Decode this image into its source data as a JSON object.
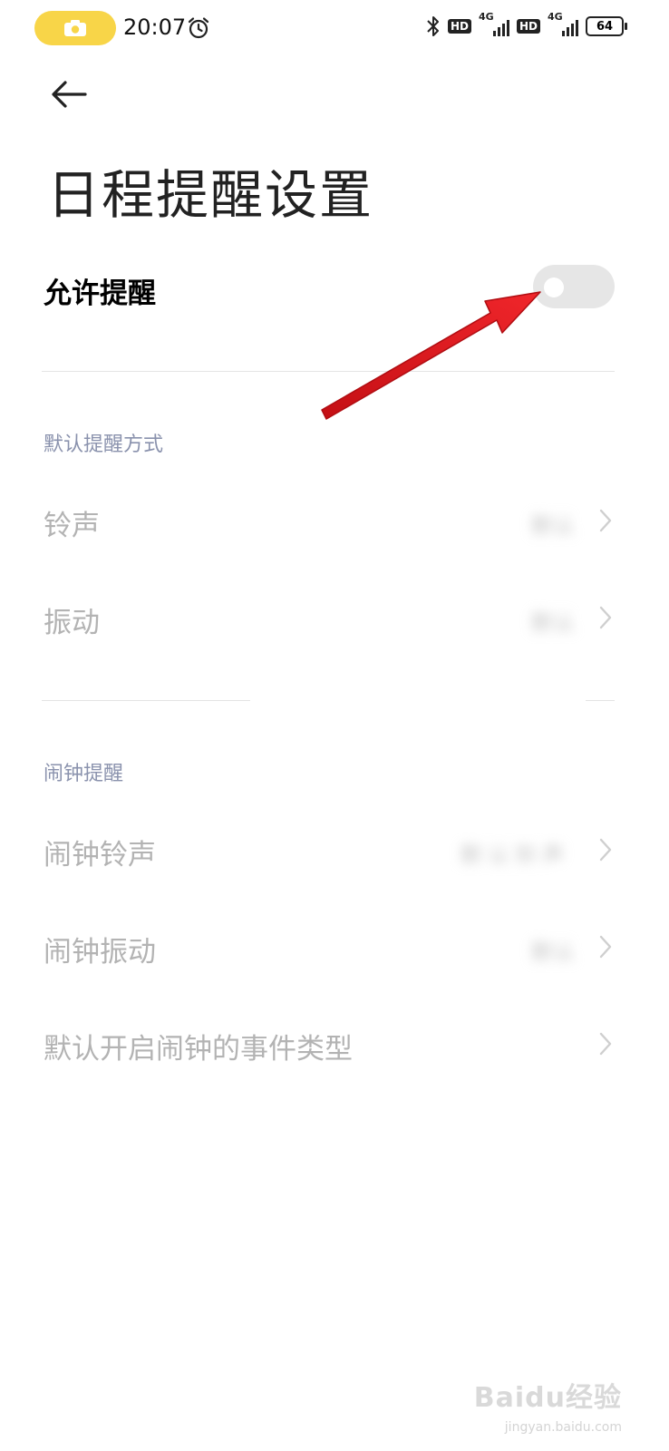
{
  "status_bar": {
    "time": "20:07",
    "hd_label_1": "HD",
    "net_label_1": "4G",
    "hd_label_2": "HD",
    "net_label_2": "4G",
    "battery": "64",
    "icons": [
      "camera-icon",
      "alarm-icon",
      "bluetooth-icon",
      "signal-icon",
      "battery-icon"
    ],
    "pill_color": "#f8d548"
  },
  "header": {
    "back_icon": "back-arrow-icon",
    "title": "日程提醒设置"
  },
  "allow_reminder": {
    "label": "允许提醒",
    "enabled": false
  },
  "sections": [
    {
      "header": "默认提醒方式",
      "items": [
        {
          "label": "铃声",
          "value": "默认"
        },
        {
          "label": "振动",
          "value": "默认"
        }
      ]
    },
    {
      "header": "闹钟提醒",
      "items": [
        {
          "label": "闹钟铃声",
          "value": "默认铃声"
        },
        {
          "label": "闹钟振动",
          "value": "默认"
        },
        {
          "label": "默认开启闹钟的事件类型",
          "value": ""
        }
      ]
    }
  ],
  "watermark": {
    "text": "Baidu经验",
    "sub": "jingyan.baidu.com"
  },
  "colors": {
    "section_header": "#8a92ad",
    "disabled_text": "#b3b3b3",
    "annotation_arrow": "#e3161b"
  }
}
